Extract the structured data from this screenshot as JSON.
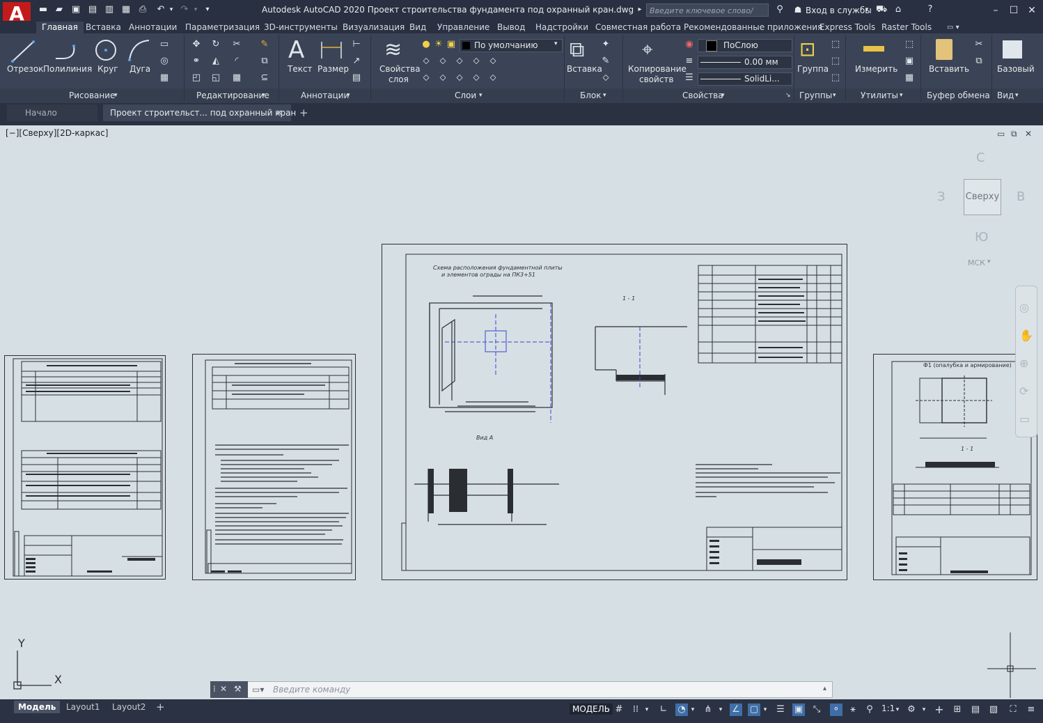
{
  "app": {
    "title": "Autodesk AutoCAD 2020   Проект строительства фундамента под охранный кран.dwg",
    "logo": "A",
    "search_placeholder": "Введите ключевое слово/фразу",
    "sign_in": "Вход в службы",
    "accent_color": "#c31b1b"
  },
  "menu": {
    "tabs": [
      "Главная",
      "Вставка",
      "Аннотации",
      "Параметризация",
      "3D-инструменты",
      "Визуализация",
      "Вид",
      "Управление",
      "Вывод",
      "Надстройки",
      "Совместная работа",
      "Рекомендованные приложения",
      "Express Tools",
      "Raster Tools"
    ],
    "active": "Главная"
  },
  "ribbon": {
    "draw": {
      "title": "Рисование",
      "tools": [
        "Отрезок",
        "Полилиния",
        "Круг",
        "Дуга"
      ]
    },
    "modify": {
      "title": "Редактирование"
    },
    "annotation": {
      "title": "Аннотации",
      "tools": [
        "Текст",
        "Размер"
      ]
    },
    "layers": {
      "title": "Слои",
      "props_label_1": "Свойства",
      "props_label_2": "слоя",
      "current_layer": "По умолчанию"
    },
    "block": {
      "title": "Блок",
      "insert_label": "Вставка"
    },
    "properties": {
      "title": "Свойства",
      "match_label_1": "Копирование",
      "match_label_2": "свойств",
      "color": "ПоСлою",
      "lineweight": "0.00 мм",
      "linetype": "SolidLi..."
    },
    "groups": {
      "title": "Группы",
      "group_label": "Группа"
    },
    "utilities": {
      "title": "Утилиты",
      "measure_label": "Измерить"
    },
    "clipboard": {
      "title": "Буфер обмена",
      "paste_label": "Вставить"
    },
    "view": {
      "title": "Вид",
      "base_label": "Базовый"
    }
  },
  "doc_tabs": {
    "start": "Начало",
    "current": "Проект строительст... под охранный кран"
  },
  "viewport": {
    "label": "[−][Сверху][2D-каркас]",
    "viewcube": {
      "top": "Сверху",
      "north": "С",
      "south": "Ю",
      "west": "З",
      "east": "В",
      "ucs": "МСК"
    },
    "ucs_x": "X",
    "ucs_y": "Y"
  },
  "drawing": {
    "main_title_1": "Схема расположения фундаментной плиты",
    "main_title_2": "и элементов ограды  на ПК3+51",
    "section_label": "1 - 1",
    "view_label": "Вид А",
    "right_sheet_title": "Ф1 (опалубка и армирование)",
    "right_section_label": "1 - 1"
  },
  "command": {
    "placeholder": "Введите  команду"
  },
  "status": {
    "tabs": [
      "Модель",
      "Layout1",
      "Layout2"
    ],
    "model_label": "МОДЕЛЬ",
    "scale": "1:1"
  }
}
